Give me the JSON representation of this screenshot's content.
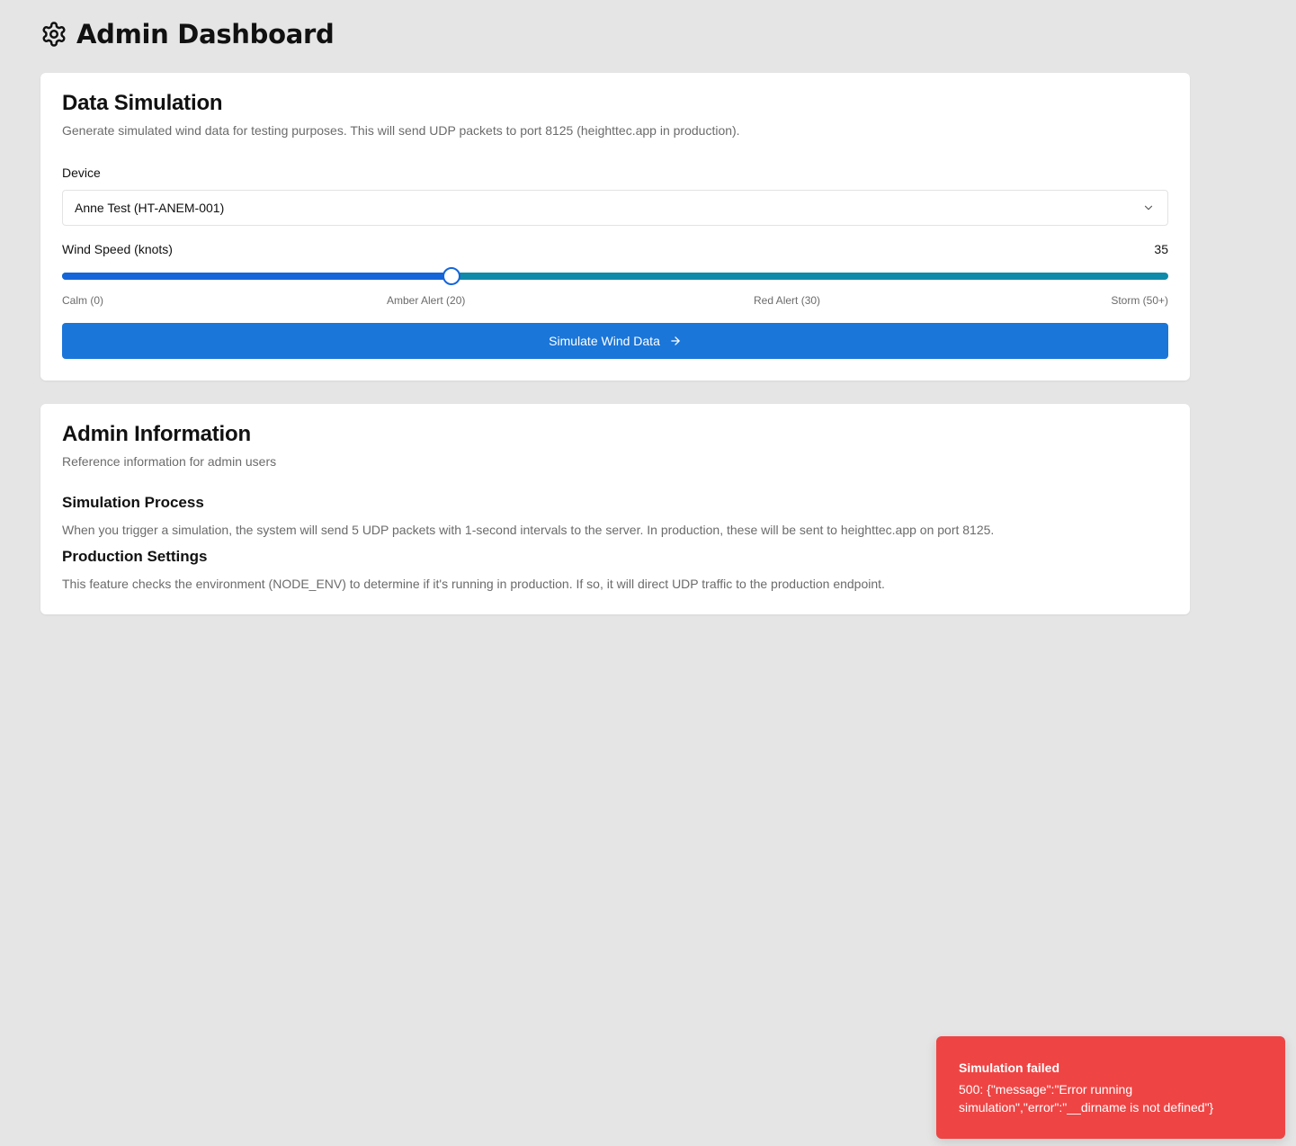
{
  "header": {
    "title": "Admin Dashboard",
    "icon": "gear-icon"
  },
  "simulation": {
    "title": "Data Simulation",
    "description": "Generate simulated wind data for testing purposes. This will send UDP packets to port 8125 (heighttec.app in production).",
    "device_label": "Device",
    "device_selected": "Anne Test (HT-ANEM-001)",
    "wind_label": "Wind Speed (knots)",
    "wind_value": "35",
    "slider": {
      "min": 0,
      "max": 50,
      "value": 17.6
    },
    "scale": {
      "calm": "Calm (0)",
      "amber": "Amber Alert (20)",
      "red": "Red Alert (30)",
      "storm": "Storm (50+)"
    },
    "button_label": "Simulate Wind Data",
    "colors": {
      "fill": "#1565d8",
      "track": "#0f8aa8",
      "button": "#1a76d9"
    }
  },
  "info": {
    "title": "Admin Information",
    "description": "Reference information for admin users",
    "process_title": "Simulation Process",
    "process_text": "When you trigger a simulation, the system will send 5 UDP packets with 1-second intervals to the server. In production, these will be sent to heighttec.app on port 8125.",
    "production_title": "Production Settings",
    "production_text": "This feature checks the environment (NODE_ENV) to determine if it's running in production. If so, it will direct UDP traffic to the production endpoint."
  },
  "toast": {
    "title": "Simulation failed",
    "message": "500: {\"message\":\"Error running simulation\",\"error\":\"__dirname is not defined\"}",
    "color": "#ef4444"
  }
}
